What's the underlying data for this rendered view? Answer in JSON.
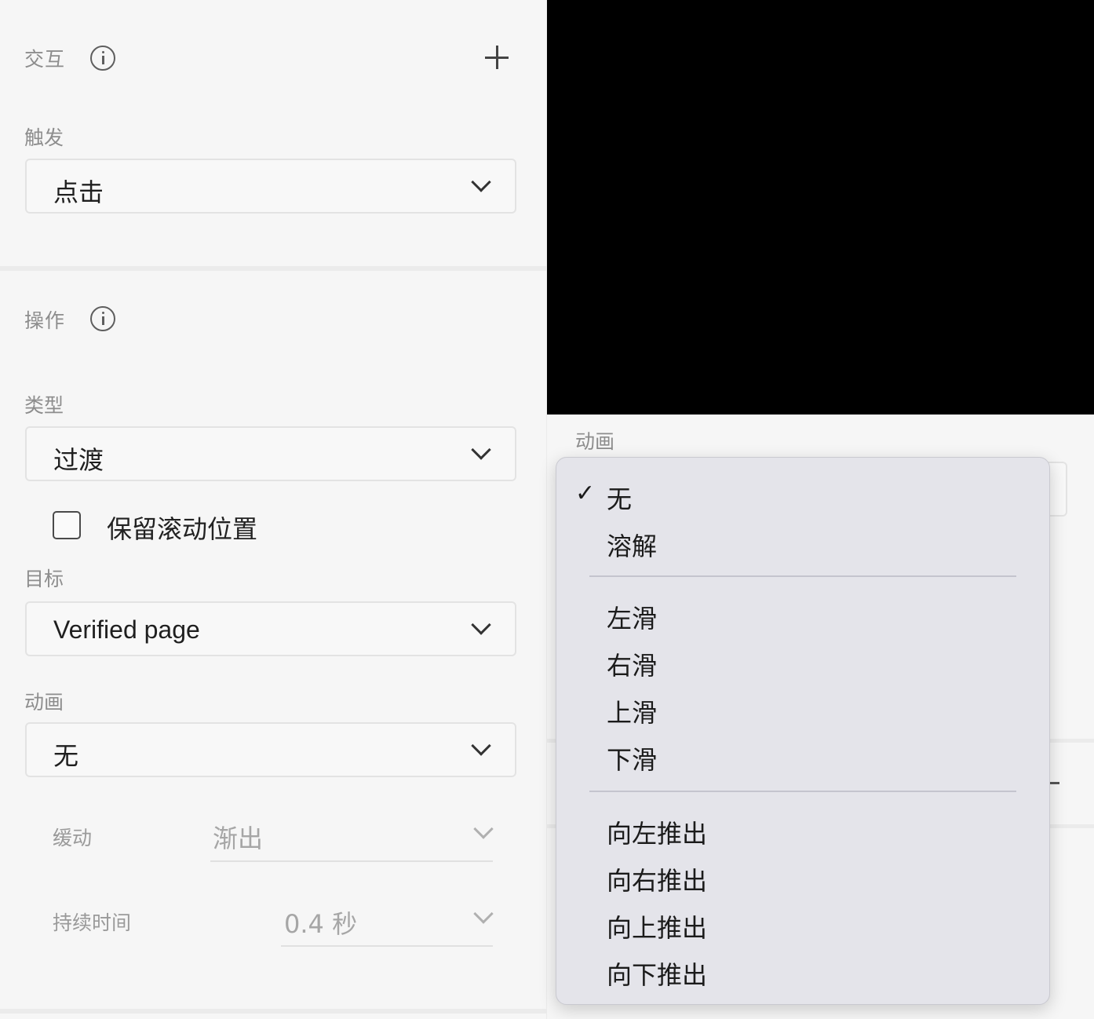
{
  "interaction": {
    "title": "交互",
    "trigger_label": "触发",
    "trigger_value": "点击"
  },
  "action": {
    "title": "操作",
    "type_label": "类型",
    "type_value": "过渡",
    "keep_scroll_label": "保留滚动位置",
    "keep_scroll_checked": false,
    "target_label": "目标",
    "target_value": "Verified page",
    "animation_label": "动画",
    "animation_value": "无",
    "easing_label": "缓动",
    "easing_value": "渐出",
    "duration_label": "持续时间",
    "duration_value": "0.4 秒"
  },
  "right_panel": {
    "animation_label": "动画"
  },
  "animation_menu": {
    "selected": "无",
    "groups": [
      [
        "无",
        "溶解"
      ],
      [
        "左滑",
        "右滑",
        "上滑",
        "下滑"
      ],
      [
        "向左推出",
        "向右推出",
        "向上推出",
        "向下推出"
      ]
    ],
    "check_glyph": "✓"
  }
}
